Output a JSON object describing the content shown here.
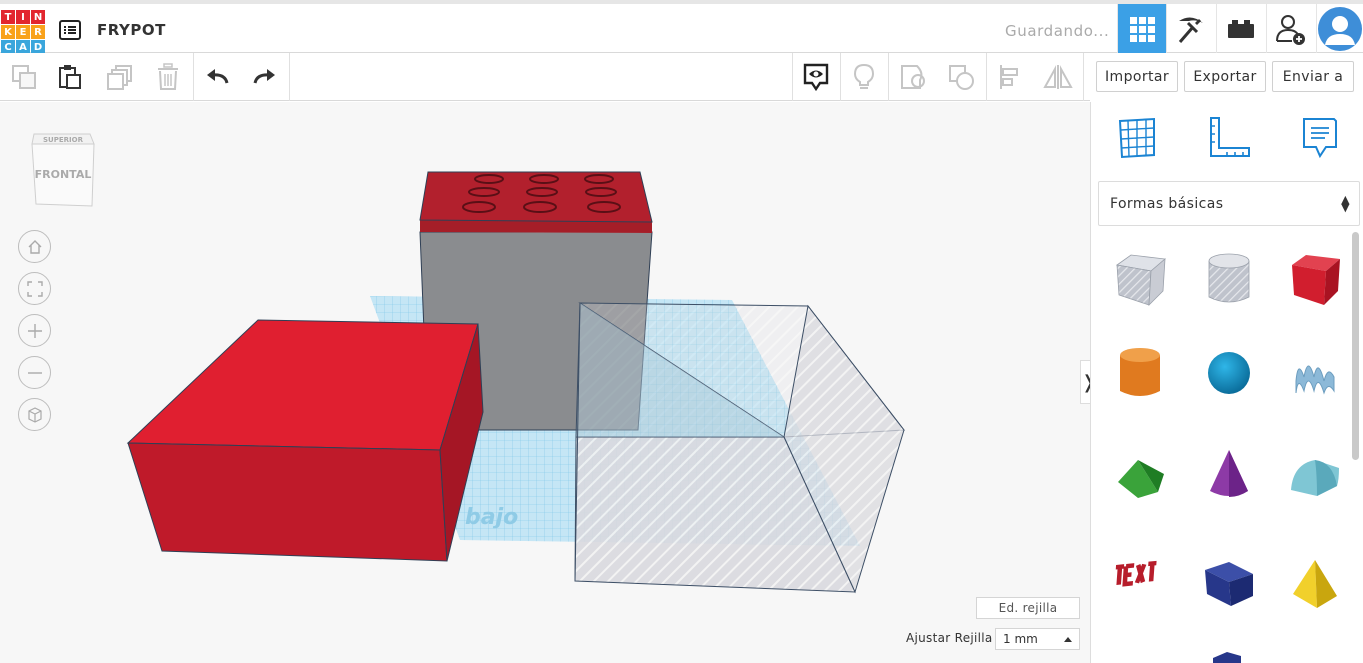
{
  "app": {
    "logo_letters": [
      "T",
      "I",
      "N",
      "K",
      "E",
      "R",
      "C",
      "A",
      "D"
    ],
    "logo_colors": [
      "#e2262f",
      "#e2262f",
      "#e2262f",
      "#f9a21b",
      "#f9a21b",
      "#f9a21b",
      "#3aa6dc",
      "#3aa6dc",
      "#3aa6dc"
    ],
    "project_title": "FRYPOT",
    "save_status": "Guardando...",
    "accent": "#3ba0e6"
  },
  "actions": {
    "import": "Importar",
    "export": "Exportar",
    "send": "Enviar a"
  },
  "viewcube": {
    "top_face": "SUPERIOR",
    "front_face": "FRONTAL"
  },
  "workplane": {
    "ground_label": "bajo",
    "edit_grid": "Ed. rejilla",
    "snap_label": "Ajustar Rejilla",
    "snap_value": "1 mm"
  },
  "panel": {
    "category": "Formas básicas",
    "shapes": [
      "box-hole",
      "cylinder-hole",
      "box",
      "cylinder",
      "sphere",
      "scribble",
      "roof",
      "cone",
      "round-roof",
      "text",
      "wedge",
      "pyramid"
    ]
  }
}
